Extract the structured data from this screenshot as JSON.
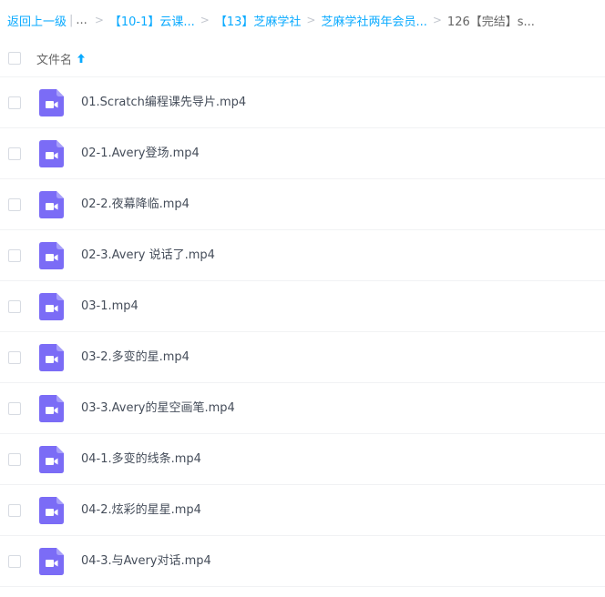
{
  "breadcrumb": {
    "back_label": "返回上一级",
    "ellipsis": "...",
    "crumbs": [
      "【10-1】云课...",
      "【13】芝麻学社",
      "芝麻学社两年会员..."
    ],
    "current": "126【完结】s..."
  },
  "list_header": {
    "filename_label": "文件名"
  },
  "files": [
    {
      "name": "01.Scratch编程课先导片.mp4"
    },
    {
      "name": "02-1.Avery登场.mp4"
    },
    {
      "name": "02-2.夜幕降临.mp4"
    },
    {
      "name": "02-3.Avery 说话了.mp4"
    },
    {
      "name": "03-1.mp4"
    },
    {
      "name": "03-2.多变的星.mp4"
    },
    {
      "name": "03-3.Avery的星空画笔.mp4"
    },
    {
      "name": "04-1.多变的线条.mp4"
    },
    {
      "name": "04-2.炫彩的星星.mp4"
    },
    {
      "name": "04-3.与Avery对话.mp4"
    }
  ],
  "colors": {
    "link": "#09aaff",
    "video_icon": "#7b6cf6",
    "text": "#454d5a"
  },
  "icons": {
    "file": "video-file-icon",
    "sort": "arrow-up-icon"
  }
}
